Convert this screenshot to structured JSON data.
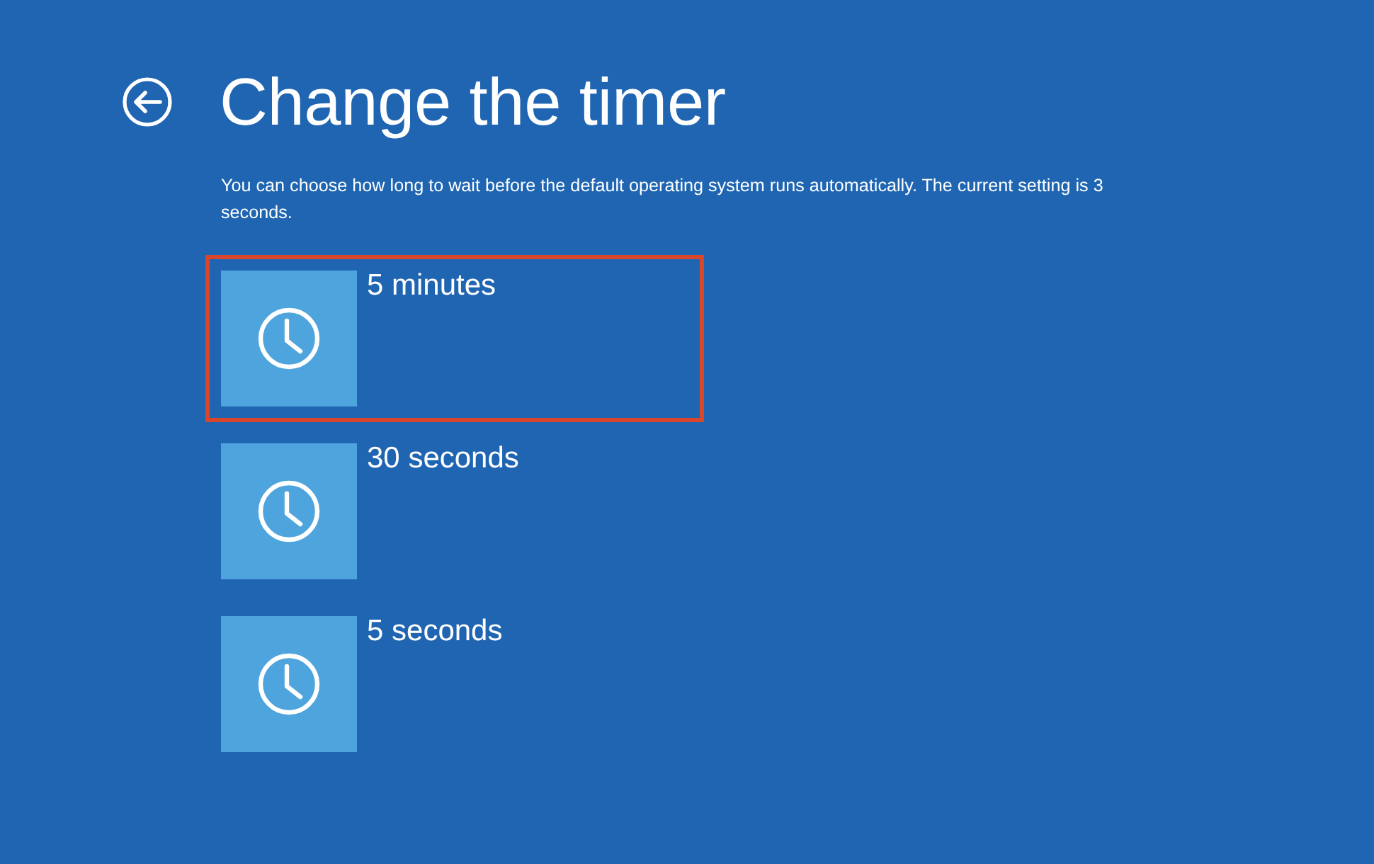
{
  "header": {
    "title": "Change the timer"
  },
  "description": "You can choose how long to wait before the default operating system runs automatically. The current setting is 3 seconds.",
  "options": [
    {
      "label": "5 minutes",
      "highlighted": true
    },
    {
      "label": "30 seconds",
      "highlighted": false
    },
    {
      "label": "5 seconds",
      "highlighted": false
    }
  ]
}
